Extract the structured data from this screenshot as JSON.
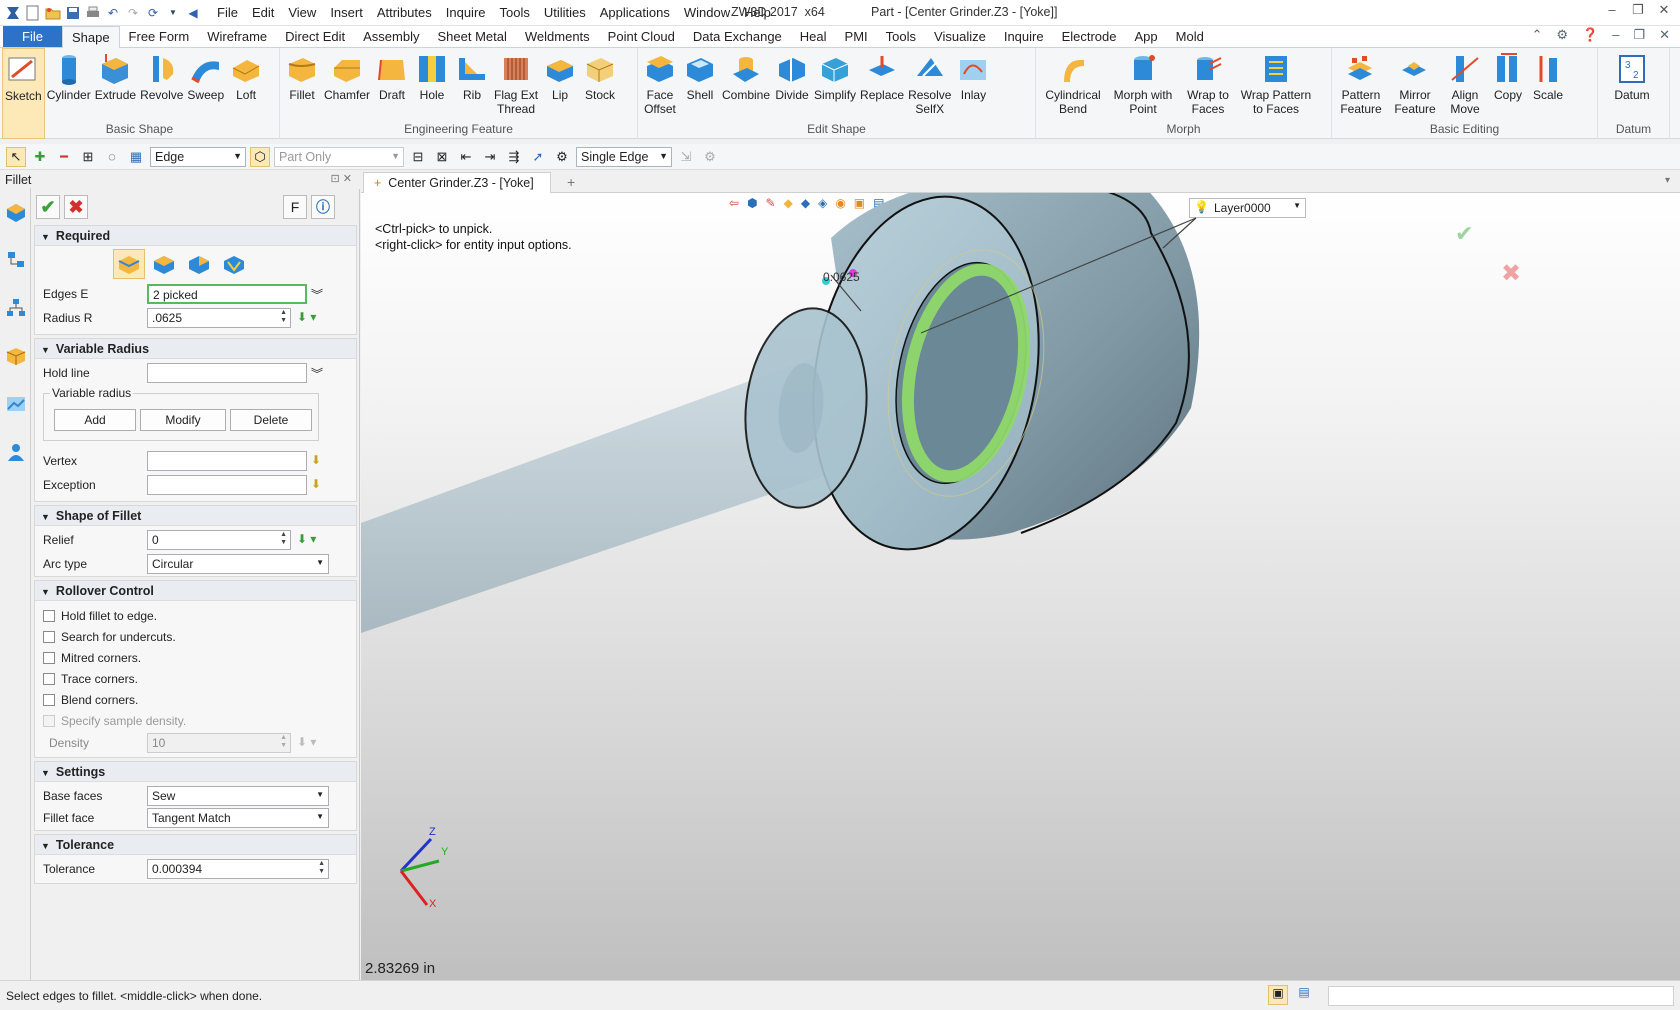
{
  "app": {
    "title": "ZW3D 2017  x64",
    "document": "Part - [Center Grinder.Z3 - [Yoke]]"
  },
  "menu": [
    "File",
    "Edit",
    "View",
    "Insert",
    "Attributes",
    "Inquire",
    "Tools",
    "Utilities",
    "Applications",
    "Window",
    "Help"
  ],
  "ribbon_tabs": [
    "File",
    "Shape",
    "Free Form",
    "Wireframe",
    "Direct Edit",
    "Assembly",
    "Sheet Metal",
    "Weldments",
    "Point Cloud",
    "Data Exchange",
    "Heal",
    "PMI",
    "Tools",
    "Visualize",
    "Inquire",
    "Electrode",
    "App",
    "Mold"
  ],
  "active_ribbon_tab": "Shape",
  "ribbon": {
    "basic_shape": {
      "label": "Basic Shape",
      "buttons": [
        "Sketch",
        "Cylinder",
        "Extrude",
        "Revolve",
        "Sweep",
        "Loft"
      ]
    },
    "engineering_feature": {
      "label": "Engineering Feature",
      "buttons": [
        "Fillet",
        "Chamfer",
        "Draft",
        "Hole",
        "Rib",
        "Flag Ext\nThread",
        "Lip",
        "Stock"
      ]
    },
    "edit_shape": {
      "label": "Edit Shape",
      "buttons": [
        "Face\nOffset",
        "Shell",
        "Combine",
        "Divide",
        "Simplify",
        "Replace",
        "Resolve\nSelfX",
        "Inlay"
      ]
    },
    "morph": {
      "label": "Morph",
      "buttons": [
        "Cylindrical\nBend",
        "Morph with\nPoint",
        "Wrap to\nFaces",
        "Wrap Pattern\nto Faces"
      ]
    },
    "basic_editing": {
      "label": "Basic Editing",
      "buttons": [
        "Pattern\nFeature",
        "Mirror\nFeature",
        "Align\nMove",
        "Copy",
        "Scale"
      ]
    },
    "datum": {
      "label": "Datum",
      "buttons": [
        "Datum"
      ]
    }
  },
  "toolbar": {
    "filter": "Edge",
    "scope": "Part Only",
    "pick_mode": "Single Edge"
  },
  "panel": {
    "title": "Fillet",
    "f_button": "F",
    "required": {
      "header": "Required",
      "edges_label": "Edges E",
      "edges_value": "2 picked",
      "radius_label": "Radius R",
      "radius_value": ".0625"
    },
    "variable_radius": {
      "header": "Variable Radius",
      "hold_line_label": "Hold line",
      "group_label": "Variable radius",
      "add": "Add",
      "modify": "Modify",
      "delete": "Delete",
      "vertex_label": "Vertex",
      "exception_label": "Exception"
    },
    "shape_of_fillet": {
      "header": "Shape of Fillet",
      "relief_label": "Relief",
      "relief_value": "0",
      "arc_type_label": "Arc type",
      "arc_type_value": "Circular"
    },
    "rollover": {
      "header": "Rollover Control",
      "options": [
        "Hold fillet to edge.",
        "Search for undercuts.",
        "Mitred corners.",
        "Trace corners.",
        "Blend corners."
      ],
      "sample_density": "Specify sample density.",
      "density_label": "Density",
      "density_value": "10"
    },
    "settings": {
      "header": "Settings",
      "base_faces_label": "Base faces",
      "base_faces_value": "Sew",
      "fillet_face_label": "Fillet face",
      "fillet_face_value": "Tangent Match"
    },
    "tolerance": {
      "header": "Tolerance",
      "label": "Tolerance",
      "value": "0.000394"
    }
  },
  "document_tab": "Center Grinder.Z3 - [Yoke]",
  "viewport": {
    "hint_line1": "<Ctrl-pick> to unpick.",
    "hint_line2": "<right-click> for entity input options.",
    "layer": "Layer0000",
    "dimension_label": "0.0625",
    "scale_readout": "2.83269 in",
    "axis_x": "X",
    "axis_y": "Y",
    "axis_z": "Z"
  },
  "status": "Select edges to fillet.  <middle-click> when done.",
  "colors": {
    "accent": "#2b72c8",
    "fillet_highlight": "#8fd86a",
    "part_body": "#9fb9c6"
  }
}
